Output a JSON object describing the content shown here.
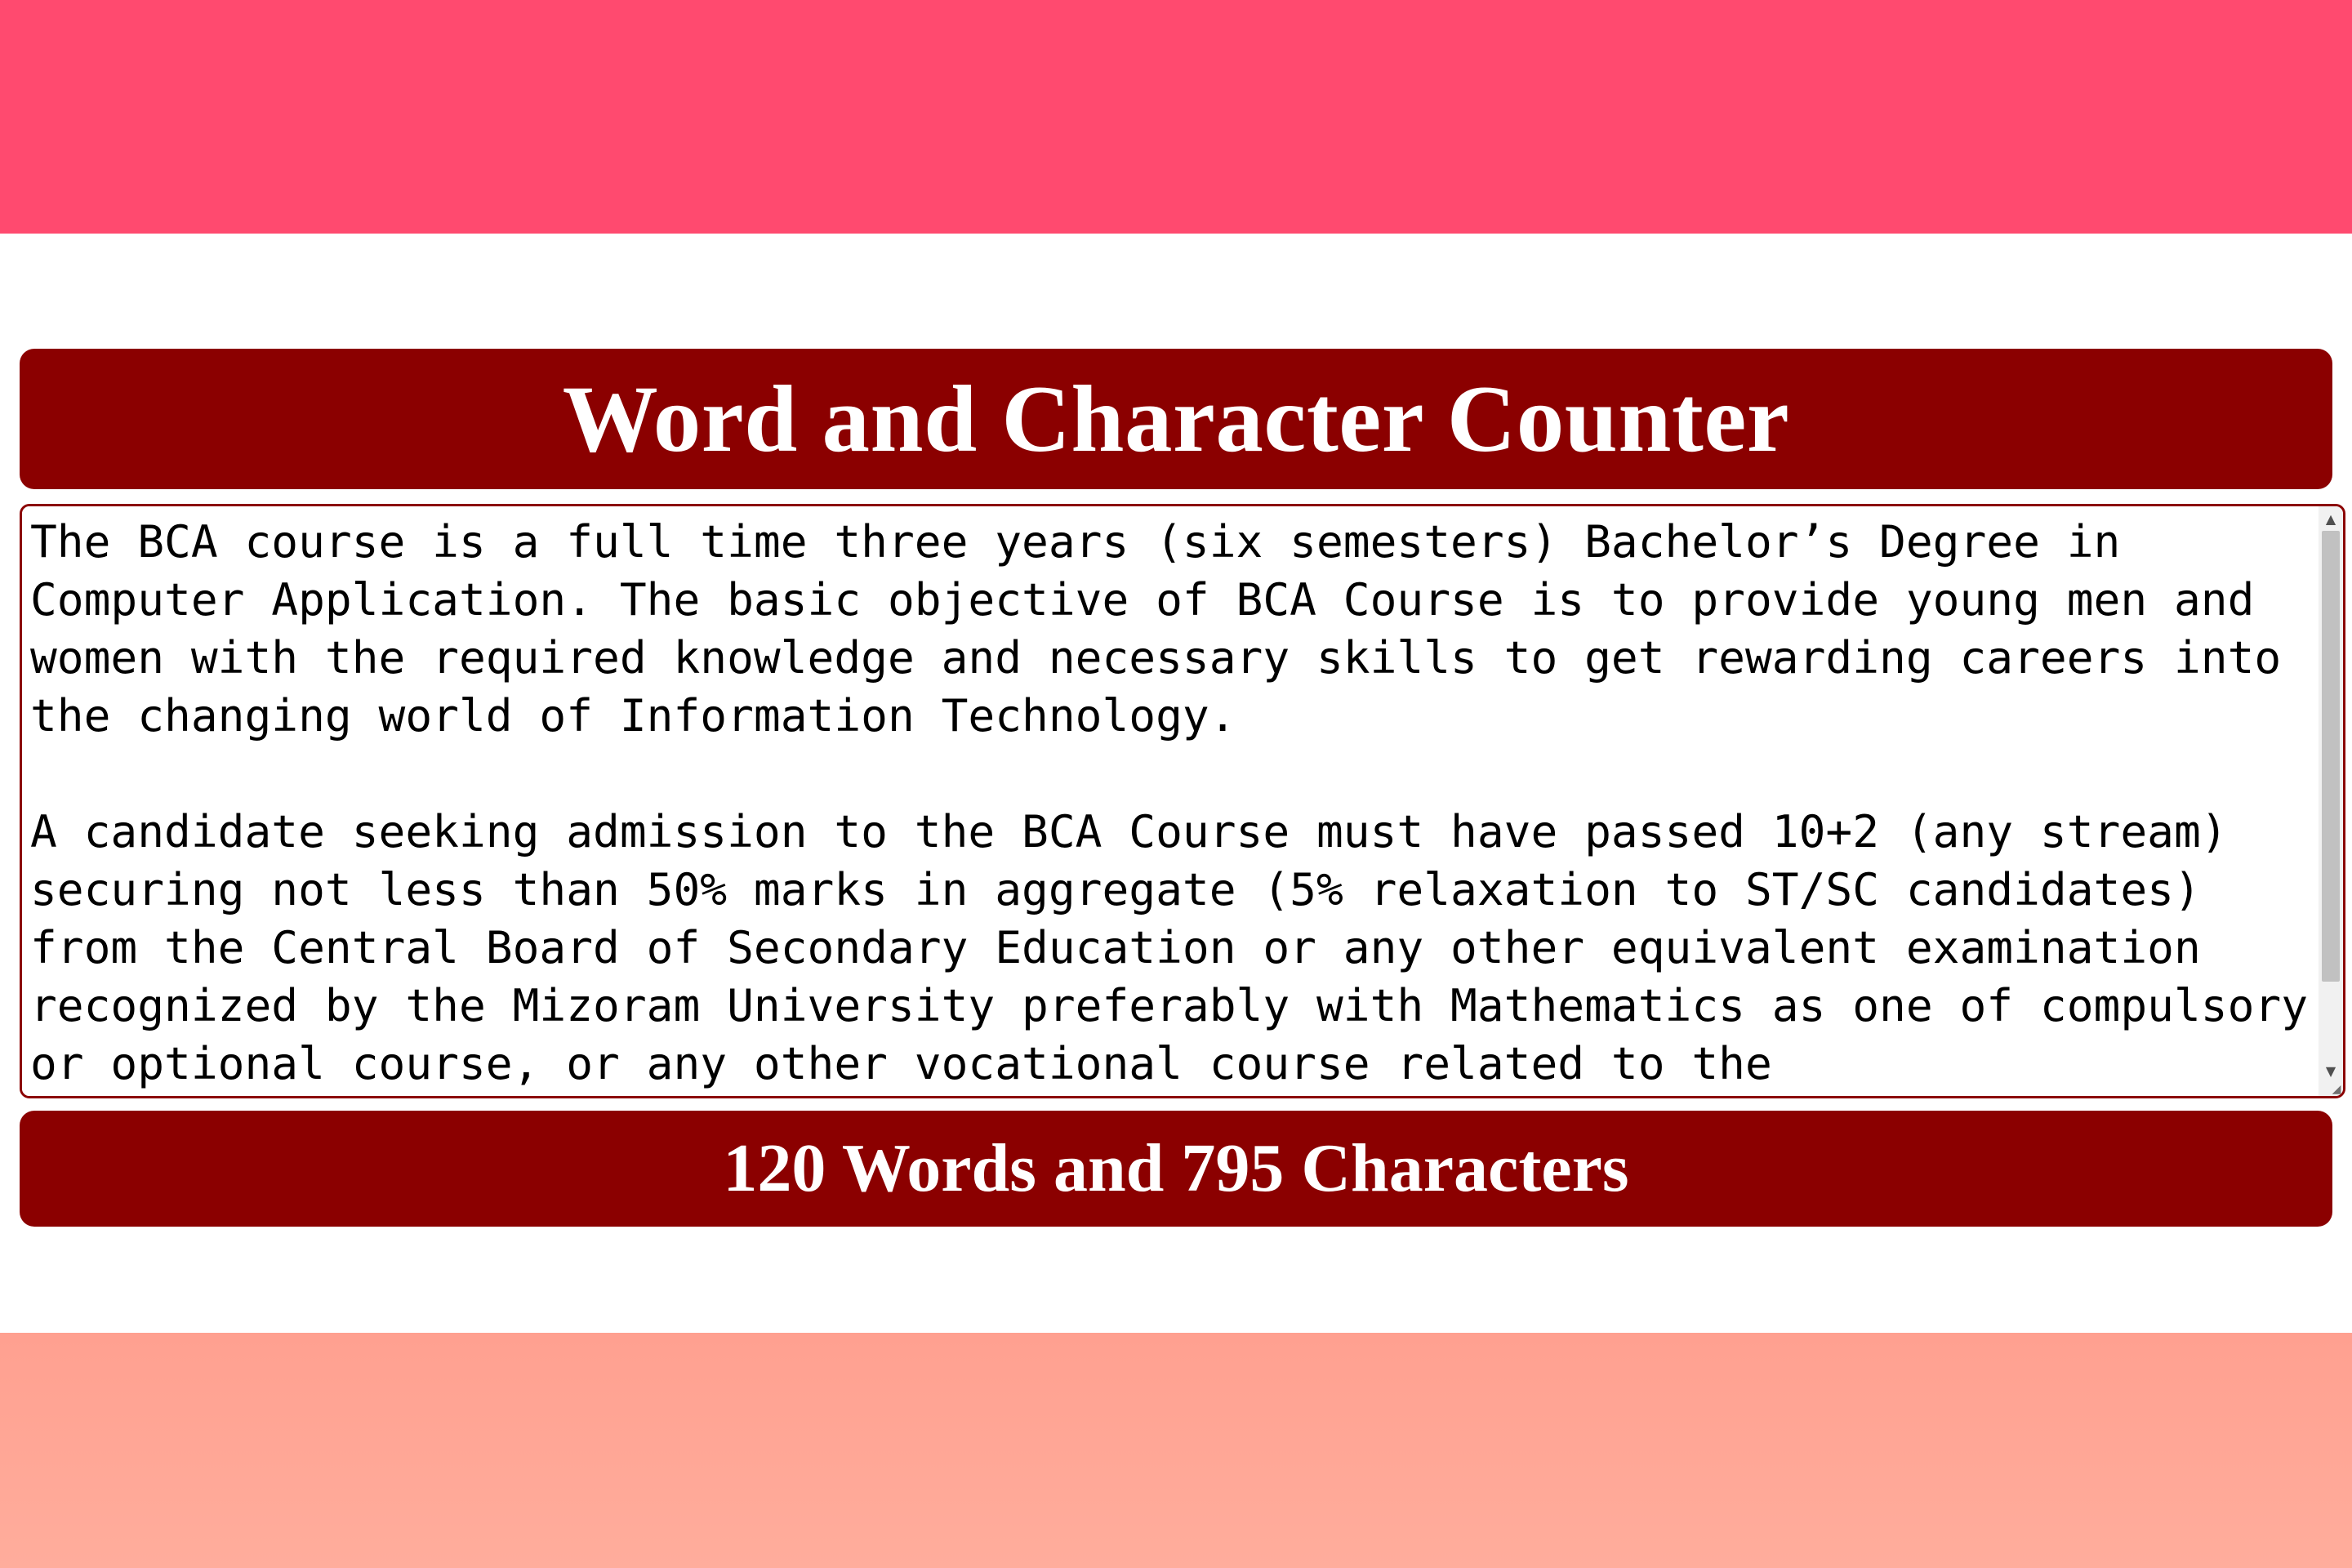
{
  "page": {
    "colors": {
      "top_band": "#ff4a6f",
      "bottom_band": "#ffa898",
      "panel": "#8b0000",
      "panel_text": "#ffffff"
    }
  },
  "header": {
    "title": "Word and Character Counter"
  },
  "editor": {
    "text": "The BCA course is a full time three years (six semesters) Bachelor’s Degree in Computer Application. The basic objective of BCA Course is to provide young men and women with the required knowledge and necessary skills to get rewarding careers into the changing world of Information Technology.\n\nA candidate seeking admission to the BCA Course must have passed 10+2 (any stream) securing not less than 50% marks in aggregate (5% relaxation to ST/SC candidates) from the Central Board of Secondary Education or any other equivalent examination recognized by the Mizoram University preferably with Mathematics as one of compulsory or optional course, or any other vocational course related to the",
    "scroll_up_icon": "chevron-up-icon",
    "scroll_down_icon": "chevron-down-icon",
    "resize_icon": "resize-grip-icon"
  },
  "counter": {
    "summary": "120 Words and 795 Characters"
  }
}
